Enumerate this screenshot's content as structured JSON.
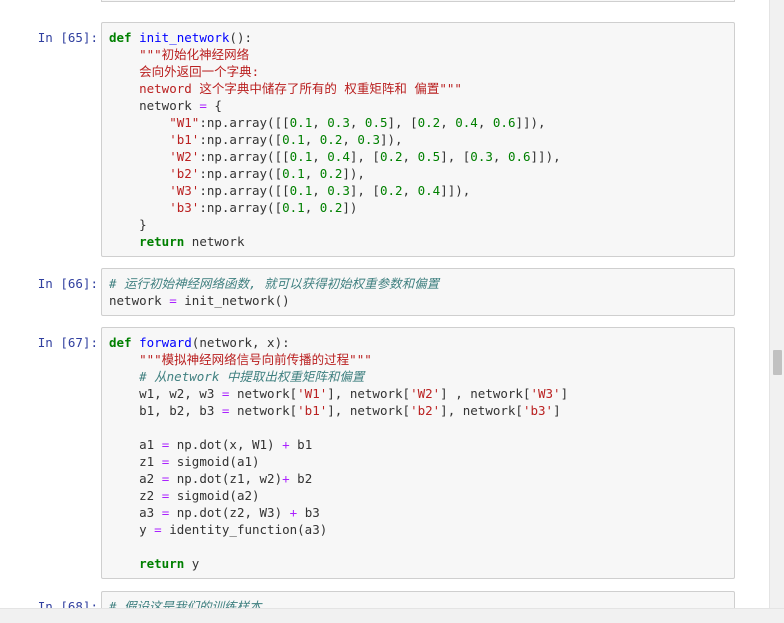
{
  "cells": [
    {
      "prompt": "In  [65]:",
      "lines": [
        [
          {
            "t": "def ",
            "c": "kw"
          },
          {
            "t": "init_network",
            "c": "fn"
          },
          {
            "t": "():",
            "c": ""
          }
        ],
        [
          {
            "t": "    ",
            "c": ""
          },
          {
            "t": "\"\"\"初始化神经网络",
            "c": "str"
          }
        ],
        [
          {
            "t": "    ",
            "c": ""
          },
          {
            "t": "会向外返回一个字典:",
            "c": "str"
          }
        ],
        [
          {
            "t": "    ",
            "c": ""
          },
          {
            "t": "netword 这个字典中储存了所有的 权重矩阵和 偏置\"\"\"",
            "c": "str"
          }
        ],
        [
          {
            "t": "    network ",
            "c": ""
          },
          {
            "t": "=",
            "c": "op"
          },
          {
            "t": " {",
            "c": ""
          }
        ],
        [
          {
            "t": "        ",
            "c": ""
          },
          {
            "t": "\"W1\"",
            "c": "str"
          },
          {
            "t": ":np.array([[",
            "c": ""
          },
          {
            "t": "0.1",
            "c": "num"
          },
          {
            "t": ", ",
            "c": ""
          },
          {
            "t": "0.3",
            "c": "num"
          },
          {
            "t": ", ",
            "c": ""
          },
          {
            "t": "0.5",
            "c": "num"
          },
          {
            "t": "], [",
            "c": ""
          },
          {
            "t": "0.2",
            "c": "num"
          },
          {
            "t": ", ",
            "c": ""
          },
          {
            "t": "0.4",
            "c": "num"
          },
          {
            "t": ", ",
            "c": ""
          },
          {
            "t": "0.6",
            "c": "num"
          },
          {
            "t": "]]),",
            "c": ""
          }
        ],
        [
          {
            "t": "        ",
            "c": ""
          },
          {
            "t": "'b1'",
            "c": "str"
          },
          {
            "t": ":np.array([",
            "c": ""
          },
          {
            "t": "0.1",
            "c": "num"
          },
          {
            "t": ", ",
            "c": ""
          },
          {
            "t": "0.2",
            "c": "num"
          },
          {
            "t": ", ",
            "c": ""
          },
          {
            "t": "0.3",
            "c": "num"
          },
          {
            "t": "]),",
            "c": ""
          }
        ],
        [
          {
            "t": "        ",
            "c": ""
          },
          {
            "t": "'W2'",
            "c": "str"
          },
          {
            "t": ":np.array([[",
            "c": ""
          },
          {
            "t": "0.1",
            "c": "num"
          },
          {
            "t": ", ",
            "c": ""
          },
          {
            "t": "0.4",
            "c": "num"
          },
          {
            "t": "], [",
            "c": ""
          },
          {
            "t": "0.2",
            "c": "num"
          },
          {
            "t": ", ",
            "c": ""
          },
          {
            "t": "0.5",
            "c": "num"
          },
          {
            "t": "], [",
            "c": ""
          },
          {
            "t": "0.3",
            "c": "num"
          },
          {
            "t": ", ",
            "c": ""
          },
          {
            "t": "0.6",
            "c": "num"
          },
          {
            "t": "]]),",
            "c": ""
          }
        ],
        [
          {
            "t": "        ",
            "c": ""
          },
          {
            "t": "'b2'",
            "c": "str"
          },
          {
            "t": ":np.array([",
            "c": ""
          },
          {
            "t": "0.1",
            "c": "num"
          },
          {
            "t": ", ",
            "c": ""
          },
          {
            "t": "0.2",
            "c": "num"
          },
          {
            "t": "]),",
            "c": ""
          }
        ],
        [
          {
            "t": "        ",
            "c": ""
          },
          {
            "t": "'W3'",
            "c": "str"
          },
          {
            "t": ":np.array([[",
            "c": ""
          },
          {
            "t": "0.1",
            "c": "num"
          },
          {
            "t": ", ",
            "c": ""
          },
          {
            "t": "0.3",
            "c": "num"
          },
          {
            "t": "], [",
            "c": ""
          },
          {
            "t": "0.2",
            "c": "num"
          },
          {
            "t": ", ",
            "c": ""
          },
          {
            "t": "0.4",
            "c": "num"
          },
          {
            "t": "]]),",
            "c": ""
          }
        ],
        [
          {
            "t": "        ",
            "c": ""
          },
          {
            "t": "'b3'",
            "c": "str"
          },
          {
            "t": ":np.array([",
            "c": ""
          },
          {
            "t": "0.1",
            "c": "num"
          },
          {
            "t": ", ",
            "c": ""
          },
          {
            "t": "0.2",
            "c": "num"
          },
          {
            "t": "])",
            "c": ""
          }
        ],
        [
          {
            "t": "    }",
            "c": ""
          }
        ],
        [
          {
            "t": "    ",
            "c": ""
          },
          {
            "t": "return",
            "c": "kw"
          },
          {
            "t": " network",
            "c": ""
          }
        ]
      ]
    },
    {
      "prompt": "In  [66]:",
      "lines": [
        [
          {
            "t": "# 运行初始神经网络函数, 就可以获得初始权重参数和偏置",
            "c": "cm"
          }
        ],
        [
          {
            "t": "network ",
            "c": ""
          },
          {
            "t": "=",
            "c": "op"
          },
          {
            "t": " init_network()",
            "c": ""
          }
        ]
      ]
    },
    {
      "prompt": "In  [67]:",
      "lines": [
        [
          {
            "t": "def ",
            "c": "kw"
          },
          {
            "t": "forward",
            "c": "fn"
          },
          {
            "t": "(network, x):",
            "c": ""
          }
        ],
        [
          {
            "t": "    ",
            "c": ""
          },
          {
            "t": "\"\"\"模拟神经网络信号向前传播的过程\"\"\"",
            "c": "str"
          }
        ],
        [
          {
            "t": "    ",
            "c": ""
          },
          {
            "t": "# 从network 中提取出权重矩阵和偏置",
            "c": "cm"
          }
        ],
        [
          {
            "t": "    w1, w2, w3 ",
            "c": ""
          },
          {
            "t": "=",
            "c": "op"
          },
          {
            "t": " network[",
            "c": ""
          },
          {
            "t": "'W1'",
            "c": "str"
          },
          {
            "t": "], network[",
            "c": ""
          },
          {
            "t": "'W2'",
            "c": "str"
          },
          {
            "t": "] , network[",
            "c": ""
          },
          {
            "t": "'W3'",
            "c": "str"
          },
          {
            "t": "]",
            "c": ""
          }
        ],
        [
          {
            "t": "    b1, b2, b3 ",
            "c": ""
          },
          {
            "t": "=",
            "c": "op"
          },
          {
            "t": " network[",
            "c": ""
          },
          {
            "t": "'b1'",
            "c": "str"
          },
          {
            "t": "], network[",
            "c": ""
          },
          {
            "t": "'b2'",
            "c": "str"
          },
          {
            "t": "], network[",
            "c": ""
          },
          {
            "t": "'b3'",
            "c": "str"
          },
          {
            "t": "]",
            "c": ""
          }
        ],
        [
          {
            "t": "",
            "c": ""
          }
        ],
        [
          {
            "t": "    a1 ",
            "c": ""
          },
          {
            "t": "=",
            "c": "op"
          },
          {
            "t": " np.dot(x, W1) ",
            "c": ""
          },
          {
            "t": "+",
            "c": "op"
          },
          {
            "t": " b1",
            "c": ""
          }
        ],
        [
          {
            "t": "    z1 ",
            "c": ""
          },
          {
            "t": "=",
            "c": "op"
          },
          {
            "t": " sigmoid(a1)",
            "c": ""
          }
        ],
        [
          {
            "t": "    a2 ",
            "c": ""
          },
          {
            "t": "=",
            "c": "op"
          },
          {
            "t": " np.dot(z1, w2)",
            "c": ""
          },
          {
            "t": "+",
            "c": "op"
          },
          {
            "t": " b2",
            "c": ""
          }
        ],
        [
          {
            "t": "    z2 ",
            "c": ""
          },
          {
            "t": "=",
            "c": "op"
          },
          {
            "t": " sigmoid(a2)",
            "c": ""
          }
        ],
        [
          {
            "t": "    a3 ",
            "c": ""
          },
          {
            "t": "=",
            "c": "op"
          },
          {
            "t": " np.dot(z2, W3) ",
            "c": ""
          },
          {
            "t": "+",
            "c": "op"
          },
          {
            "t": " b3",
            "c": ""
          }
        ],
        [
          {
            "t": "    y ",
            "c": ""
          },
          {
            "t": "=",
            "c": "op"
          },
          {
            "t": " identity_function(a3)",
            "c": ""
          }
        ],
        [
          {
            "t": "",
            "c": ""
          }
        ],
        [
          {
            "t": "    ",
            "c": ""
          },
          {
            "t": "return",
            "c": "kw"
          },
          {
            "t": " y",
            "c": ""
          }
        ]
      ]
    },
    {
      "prompt": "In  [68]:",
      "lines": [
        [
          {
            "t": "# 假设这是我们的训练样本",
            "c": "cm"
          }
        ]
      ]
    }
  ]
}
